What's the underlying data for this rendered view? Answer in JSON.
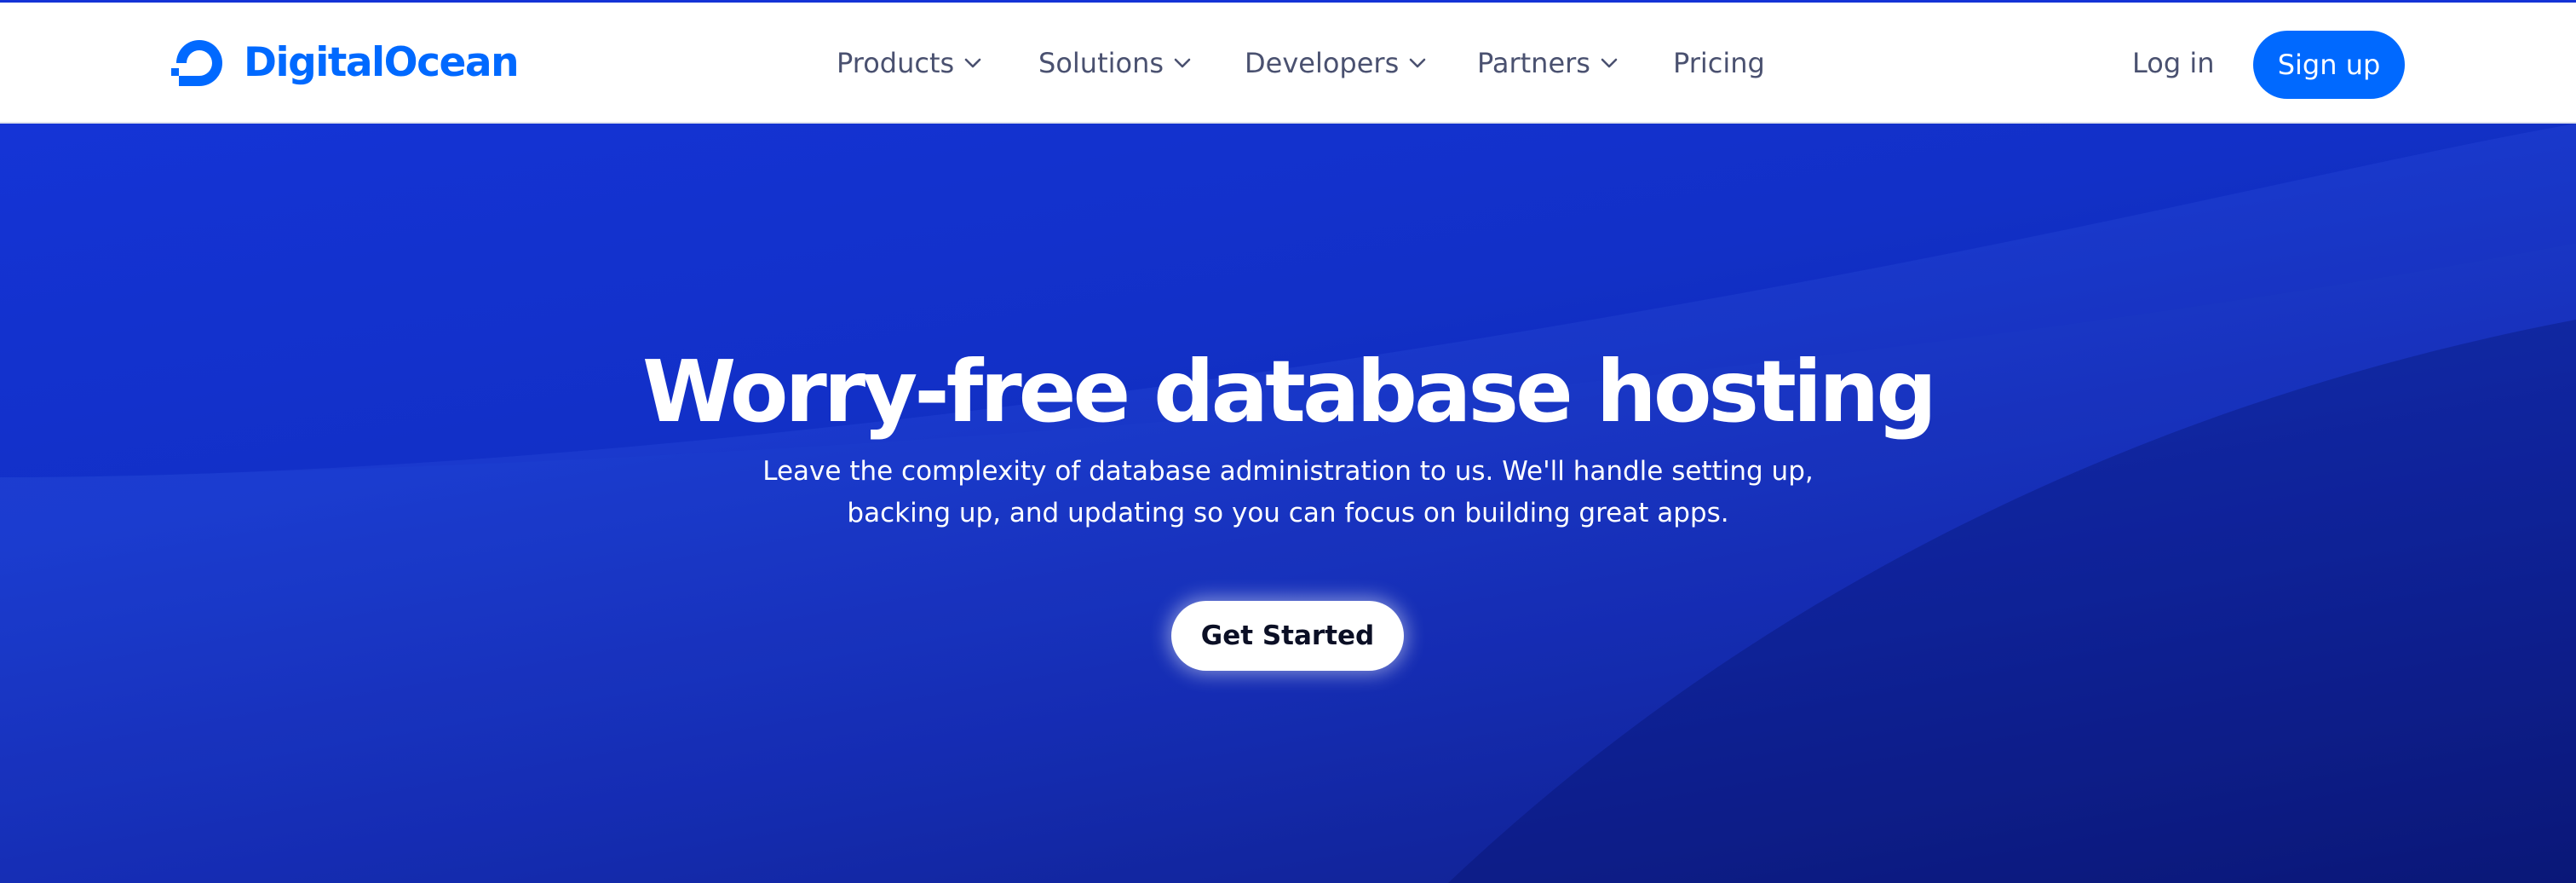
{
  "brand": {
    "name": "DigitalOcean",
    "color": "#0069ff",
    "icon": "digitalocean-logo-icon"
  },
  "nav": {
    "items": [
      {
        "label": "Products",
        "has_dropdown": true
      },
      {
        "label": "Solutions",
        "has_dropdown": true
      },
      {
        "label": "Developers",
        "has_dropdown": true
      },
      {
        "label": "Partners",
        "has_dropdown": true
      },
      {
        "label": "Pricing",
        "has_dropdown": false
      }
    ],
    "dropdown_icon": "chevron-down-icon"
  },
  "auth": {
    "login_label": "Log in",
    "signup_label": "Sign up"
  },
  "hero": {
    "title": "Worry-free database hosting",
    "subtitle_line1": "Leave the complexity of database administration to us. We'll handle setting up,",
    "subtitle_line2": "backing up, and updating so you can focus on building great apps.",
    "cta_label": "Get Started"
  },
  "colors": {
    "accent": "#0069ff",
    "nav_text": "#4a5170",
    "hero_top": "#1636d8",
    "hero_bottom": "#040e72",
    "cta_background": "#ffffff",
    "cta_text": "#0b0f25"
  }
}
